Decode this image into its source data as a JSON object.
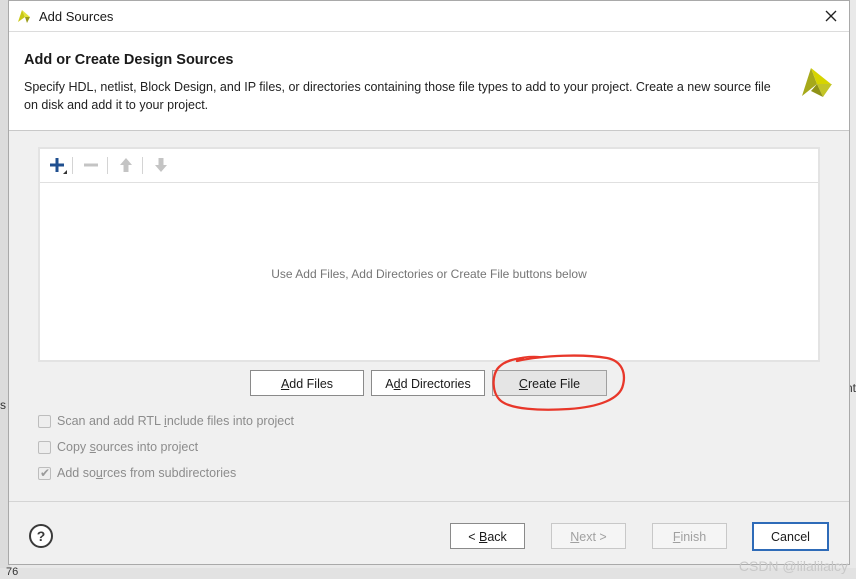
{
  "window": {
    "title": "Add Sources",
    "close_icon": "close-icon",
    "logo_icon": "vivado-logo-icon"
  },
  "header": {
    "title": "Add or Create Design Sources",
    "description": "Specify HDL, netlist, Block Design, and IP files, or directories containing those file types to add to your project. Create a new source file on disk and add it to your project."
  },
  "file_panel": {
    "toolbar": {
      "add_icon": "plus-icon",
      "remove_icon": "minus-icon",
      "move_up_icon": "arrow-up-icon",
      "move_down_icon": "arrow-down-icon"
    },
    "empty_message": "Use Add Files, Add Directories or Create File buttons below"
  },
  "actions": {
    "add_files_prefix": "",
    "add_files_mnemonic": "A",
    "add_files_suffix": "dd Files",
    "add_dirs_prefix": "A",
    "add_dirs_mnemonic": "d",
    "add_dirs_suffix": "d Directories",
    "create_file_prefix": "",
    "create_file_mnemonic": "C",
    "create_file_suffix": "reate File"
  },
  "options": {
    "scan_rtl_prefix": "Scan and add RTL ",
    "scan_rtl_mnemonic": "i",
    "scan_rtl_suffix": "nclude files into project",
    "scan_rtl_checked": false,
    "copy_prefix": "Copy ",
    "copy_mnemonic": "s",
    "copy_suffix": "ources into project",
    "copy_checked": false,
    "subdirs_prefix": "Add so",
    "subdirs_mnemonic": "u",
    "subdirs_suffix": "rces from subdirectories",
    "subdirs_checked": true
  },
  "footer": {
    "help_label": "?",
    "back_prefix": "< ",
    "back_mnemonic": "B",
    "back_suffix": "ack",
    "next_mnemonic": "N",
    "next_suffix": "ext >",
    "finish_mnemonic": "F",
    "finish_suffix": "inish",
    "cancel_label": "Cancel"
  },
  "watermark": "CSDN @lilalilalcy",
  "background": {
    "left_fragment": "s",
    "right_fragment": "nt",
    "bottom_fragment": "76"
  },
  "colors": {
    "annotation_circle": "#e8372a",
    "primary_border": "#2e6bb8",
    "logo_yellow": "#d6d400",
    "logo_olive": "#a6a91a"
  }
}
